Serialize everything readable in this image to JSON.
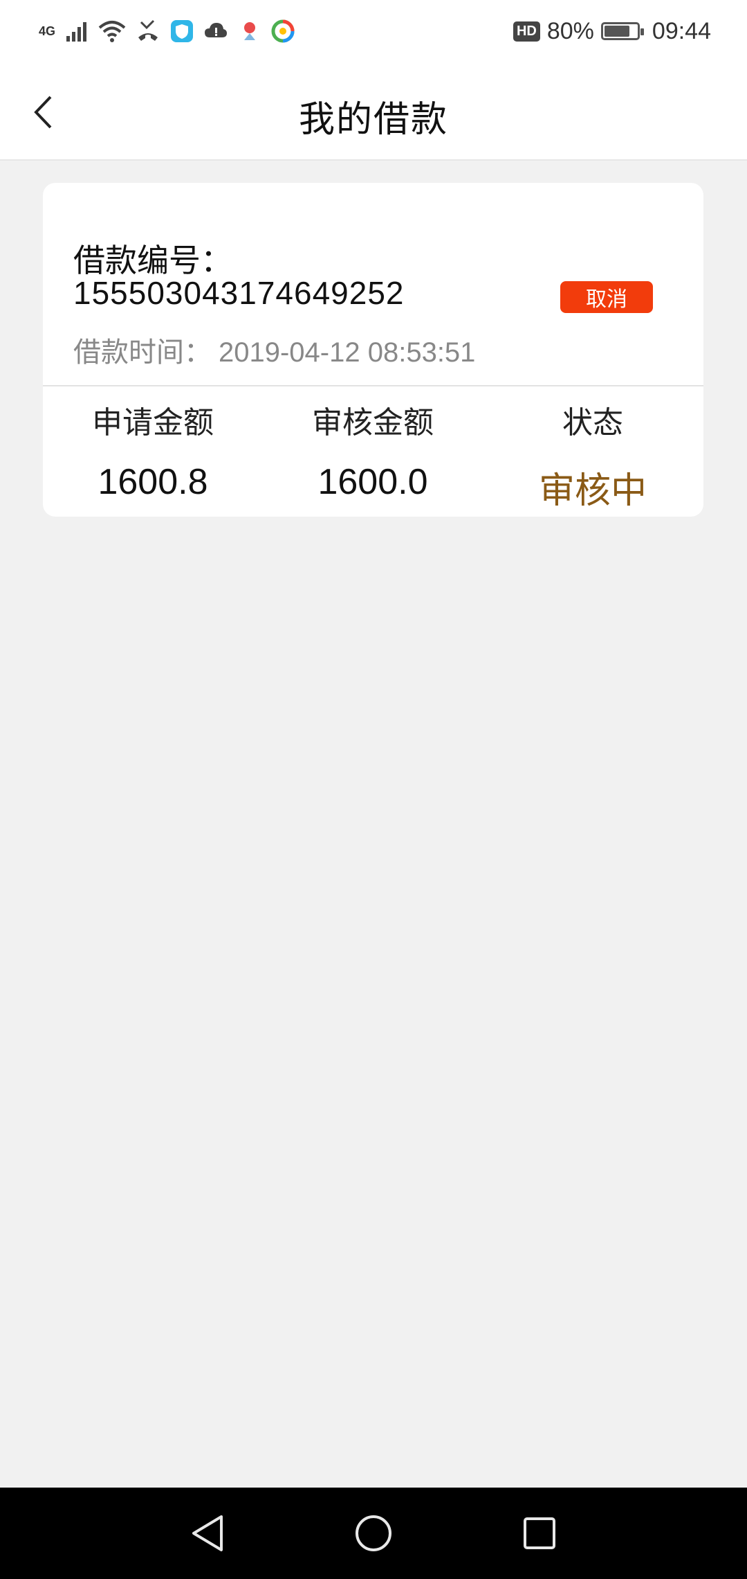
{
  "status_bar": {
    "network": "4G",
    "battery_percent": "80%",
    "battery_level": 0.8,
    "hd_label": "HD",
    "time": "09:44",
    "icons": [
      "signal-icon",
      "wifi-icon",
      "missed-call-icon",
      "shield-app-icon",
      "cloud-icon",
      "map-pin-app-icon",
      "browser-app-icon"
    ]
  },
  "header": {
    "title": "我的借款"
  },
  "loan_card": {
    "number_label": "借款编号：",
    "number_value": "155503043174649252",
    "cancel_label": "取消",
    "time_label": "借款时间：",
    "time_value": "2019-04-12 08:53:51",
    "columns": [
      {
        "header": "申请金额",
        "value": "1600.8"
      },
      {
        "header": "审核金额",
        "value": "1600.0"
      },
      {
        "header": "状态",
        "value": "审核中"
      }
    ]
  },
  "colors": {
    "accent_red": "#f23c0c",
    "status_brown": "#8a5a16",
    "background": "#f1f1f1"
  }
}
